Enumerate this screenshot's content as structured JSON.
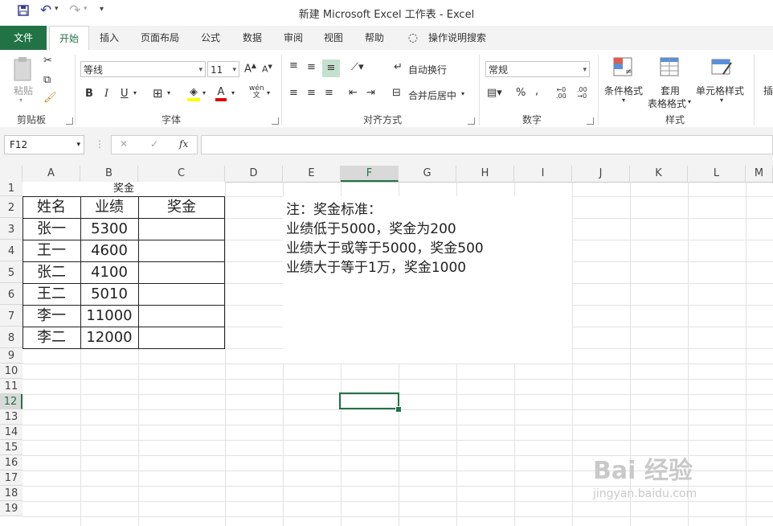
{
  "titlebar": {
    "title": "新建 Microsoft Excel 工作表  -  Excel",
    "save_icon": "save-icon",
    "undo_icon": "undo-icon",
    "redo_icon": "redo-icon",
    "customize": "▾"
  },
  "tabs": [
    "文件",
    "开始",
    "插入",
    "页面布局",
    "公式",
    "数据",
    "审阅",
    "视图",
    "帮助",
    "操作说明搜索"
  ],
  "ribbon": {
    "clipboard": {
      "paste": "粘贴",
      "label": "剪贴板"
    },
    "font": {
      "name": "等线",
      "size": "11",
      "grow": "A",
      "shrink": "A",
      "bold": "B",
      "italic": "I",
      "underline": "U",
      "label": "字体",
      "phonetic": "wén"
    },
    "alignment": {
      "wrap": "自动换行",
      "merge": "合并后居中",
      "label": "对齐方式"
    },
    "number": {
      "format": "常规",
      "percent": "%",
      "comma": ",",
      "label": "数字"
    },
    "styles": {
      "conditional": "条件格式",
      "table": "套用",
      "table2": "表格格式",
      "cell": "单元格样式",
      "label": "样式"
    },
    "insert_partial": "插"
  },
  "formula_bar": {
    "namebox": "F12",
    "fx": "fx",
    "cancel": "✕",
    "confirm": "✓",
    "value": ""
  },
  "columns": [
    "A",
    "B",
    "C",
    "D",
    "E",
    "F",
    "G",
    "H",
    "I",
    "J",
    "K",
    "L",
    "M"
  ],
  "rows": [
    "1",
    "2",
    "3",
    "4",
    "5",
    "6",
    "7",
    "8",
    "9",
    "10",
    "11",
    "12",
    "13",
    "14",
    "15",
    "16",
    "17",
    "18",
    "19"
  ],
  "sheet": {
    "title_cell": "奖金",
    "headers": [
      "姓名",
      "业绩",
      "奖金"
    ],
    "data": [
      {
        "name": "张一",
        "perf": "5300",
        "bonus": ""
      },
      {
        "name": "王一",
        "perf": "4600",
        "bonus": ""
      },
      {
        "name": "张二",
        "perf": "4100",
        "bonus": ""
      },
      {
        "name": "王二",
        "perf": "5010",
        "bonus": ""
      },
      {
        "name": "李一",
        "perf": "11000",
        "bonus": ""
      },
      {
        "name": "李二",
        "perf": "12000",
        "bonus": ""
      }
    ],
    "notes": [
      "注：奖金标准：",
      "业绩低于5000，奖金为200",
      "业绩大于或等于5000，奖金500",
      "业绩大于等于1万，奖金1000"
    ]
  },
  "watermark": {
    "main": "Bai 经验",
    "sub": "jingyan.baidu.com"
  },
  "colors": {
    "accent": "#217346",
    "ribbon_bg": "#f3f3f3"
  }
}
